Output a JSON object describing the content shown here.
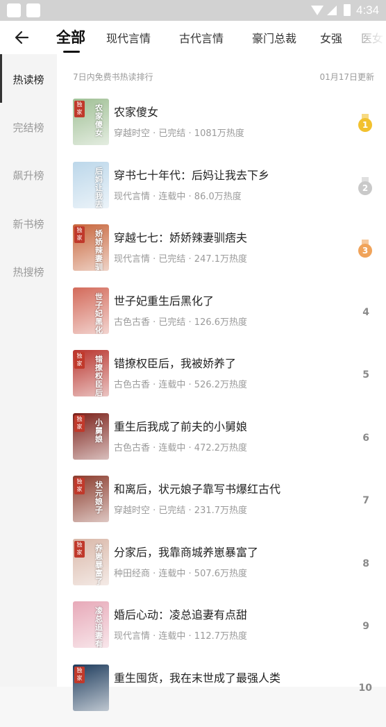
{
  "status_bar": {
    "time": "4:34"
  },
  "nav": {
    "tabs": [
      "全部",
      "现代言情",
      "古代言情",
      "豪门总裁",
      "女强",
      "医女"
    ]
  },
  "sidebar": {
    "items": [
      "热读榜",
      "完结榜",
      "飙升榜",
      "新书榜",
      "热搜榜"
    ]
  },
  "list_header": {
    "left": "7日内免费书热读排行",
    "right": "01月17日更新"
  },
  "books": [
    {
      "title": "农家傻女",
      "meta": "穿越时空 · 已完结 · 1081万热度",
      "rank": "1",
      "cover_text": "农家傻女",
      "cover_color": "#9fbf94",
      "tag": "独家"
    },
    {
      "title": "穿书七十年代：后妈让我去下乡",
      "meta": "现代言情 · 连载中 · 86.0万热度",
      "rank": "2",
      "cover_text": "后妈让我去下乡",
      "cover_color": "#bcd7ea",
      "tag": ""
    },
    {
      "title": "穿越七七：娇娇辣妻驯痞夫",
      "meta": "现代言情 · 已完结 · 247.1万热度",
      "rank": "3",
      "cover_text": "娇娇辣妻驯痞夫",
      "cover_color": "#c7653b",
      "tag": "独家"
    },
    {
      "title": "世子妃重生后黑化了",
      "meta": "古色古香 · 已完结 · 126.6万热度",
      "rank": "4",
      "cover_text": "世子妃黑化了",
      "cover_color": "#d36a5a",
      "tag": ""
    },
    {
      "title": "错撩权臣后，我被娇养了",
      "meta": "古色古香 · 连载中 · 526.2万热度",
      "rank": "5",
      "cover_text": "错撩权臣后",
      "cover_color": "#b8332c",
      "tag": "独家"
    },
    {
      "title": "重生后我成了前夫的小舅娘",
      "meta": "古色古香 · 连载中 · 472.2万热度",
      "rank": "6",
      "cover_text": "小舅娘",
      "cover_color": "#7a1f18",
      "tag": "独家"
    },
    {
      "title": "和离后，状元娘子靠写书爆红古代",
      "meta": "穿越时空 · 已完结 · 231.7万热度",
      "rank": "7",
      "cover_text": "状元娘子",
      "cover_color": "#8a3b2c",
      "tag": "独家"
    },
    {
      "title": "分家后，我靠商城养崽暴富了",
      "meta": "种田经商 · 连载中 · 507.6万热度",
      "rank": "8",
      "cover_text": "养崽暴富了",
      "cover_color": "#d9b7a8",
      "tag": "独家"
    },
    {
      "title": "婚后心动：凌总追妻有点甜",
      "meta": "现代言情 · 连载中 · 112.7万热度",
      "rank": "9",
      "cover_text": "凌总追妻有点甜",
      "cover_color": "#e7a9b8",
      "tag": ""
    },
    {
      "title": "重生囤货，我在末世成了最强人类",
      "meta": "",
      "rank": "10",
      "cover_text": "",
      "cover_color": "#1d3b5c",
      "tag": "独家"
    }
  ],
  "medals": {
    "1": "#f2c12e",
    "2": "#c9c9c9",
    "3": "#f0a35a"
  }
}
